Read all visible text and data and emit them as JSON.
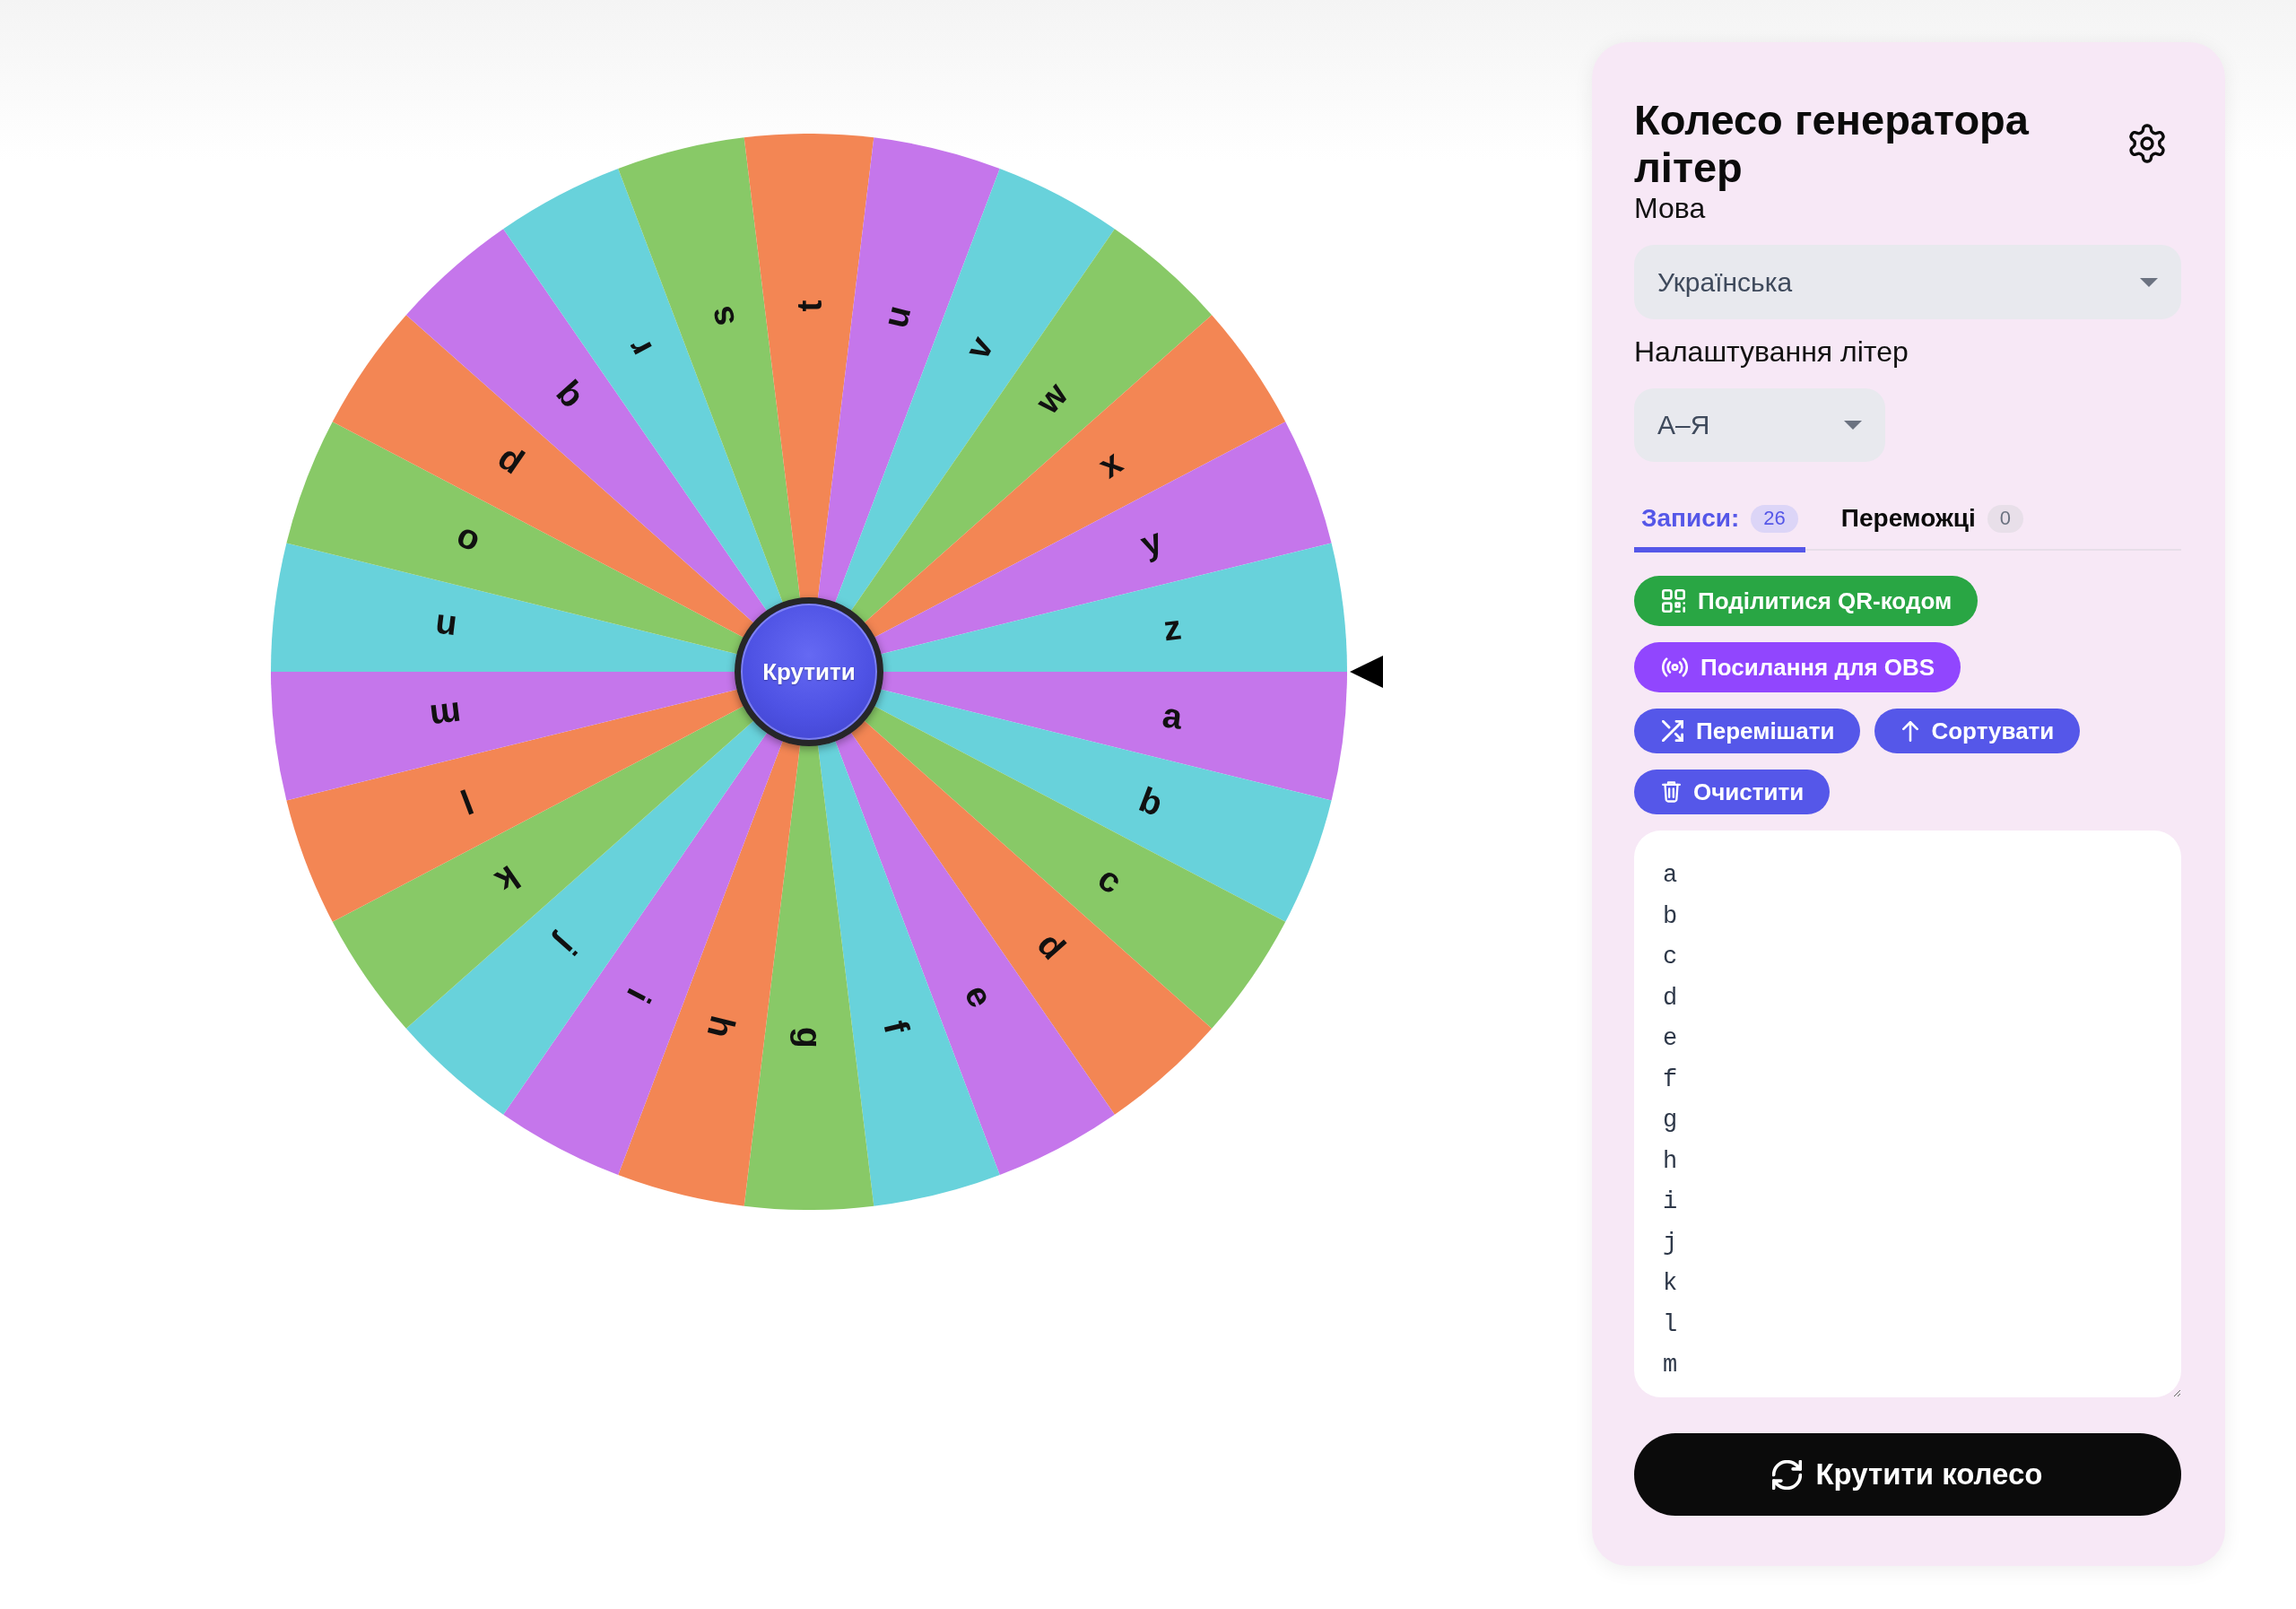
{
  "wheel": {
    "segments": [
      {
        "label": "a",
        "color": "#c576eb"
      },
      {
        "label": "b",
        "color": "#68d2db"
      },
      {
        "label": "c",
        "color": "#88c967"
      },
      {
        "label": "d",
        "color": "#f38654"
      },
      {
        "label": "e",
        "color": "#c576eb"
      },
      {
        "label": "f",
        "color": "#68d2db"
      },
      {
        "label": "g",
        "color": "#88c967"
      },
      {
        "label": "h",
        "color": "#f38654"
      },
      {
        "label": "i",
        "color": "#c576eb"
      },
      {
        "label": "j",
        "color": "#68d2db"
      },
      {
        "label": "k",
        "color": "#88c967"
      },
      {
        "label": "l",
        "color": "#f38654"
      },
      {
        "label": "m",
        "color": "#c576eb"
      },
      {
        "label": "n",
        "color": "#68d2db"
      },
      {
        "label": "o",
        "color": "#88c967"
      },
      {
        "label": "p",
        "color": "#f38654"
      },
      {
        "label": "q",
        "color": "#c576eb"
      },
      {
        "label": "r",
        "color": "#68d2db"
      },
      {
        "label": "s",
        "color": "#88c967"
      },
      {
        "label": "t",
        "color": "#f38654"
      },
      {
        "label": "u",
        "color": "#c576eb"
      },
      {
        "label": "v",
        "color": "#68d2db"
      },
      {
        "label": "w",
        "color": "#88c967"
      },
      {
        "label": "x",
        "color": "#f38654"
      },
      {
        "label": "y",
        "color": "#c576eb"
      },
      {
        "label": "z",
        "color": "#68d2db"
      }
    ],
    "spin_button": "Крутити"
  },
  "panel": {
    "title": "Колесо генератора літер",
    "language": {
      "label": "Мова",
      "value": "Українська"
    },
    "letter_set": {
      "label": "Налаштування літер",
      "value": "А–Я"
    },
    "tabs": [
      {
        "label": "Записи:",
        "count": "26",
        "selected": true
      },
      {
        "label": "Переможці",
        "count": "0",
        "selected": false
      }
    ],
    "actions": [
      {
        "label": "Поділитися QR-кодом",
        "kind": "qr"
      },
      {
        "label": "Посилання для OBS",
        "kind": "broadcast"
      },
      {
        "label": "Перемішати",
        "kind": "shuffle"
      },
      {
        "label": "Сортувати",
        "kind": "sort"
      },
      {
        "label": "Очистити",
        "kind": "clear"
      }
    ],
    "entries": [
      "a",
      "b",
      "c",
      "d",
      "e",
      "f",
      "g",
      "h",
      "i",
      "j",
      "k",
      "l",
      "m"
    ],
    "spin_button": "Крутити колесо"
  }
}
